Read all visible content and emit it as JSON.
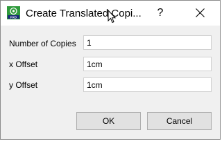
{
  "window": {
    "title": "Create Translated Copi...",
    "help_glyph": "?",
    "app_icon": "fxd-app-icon",
    "close_icon": "close-icon"
  },
  "form": {
    "copies": {
      "label": "Number of Copies",
      "value": "1"
    },
    "x_offset": {
      "label": "x Offset",
      "value": "1cm"
    },
    "y_offset": {
      "label": "y Offset",
      "value": "1cm"
    }
  },
  "buttons": {
    "ok_label": "OK",
    "cancel_label": "Cancel"
  },
  "colors": {
    "icon_green": "#2f9a3b",
    "icon_dark": "#1b2b7a"
  }
}
